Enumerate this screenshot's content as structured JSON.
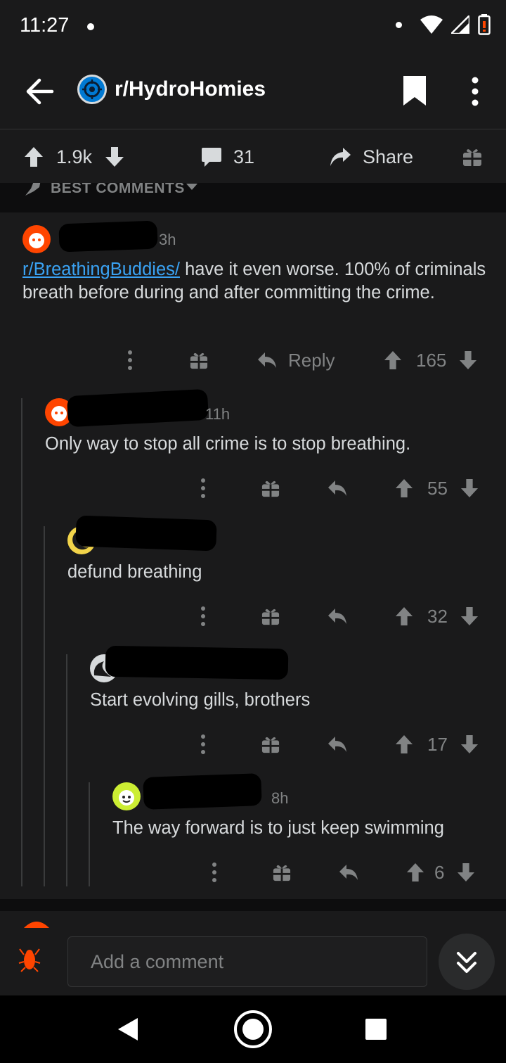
{
  "status_bar": {
    "time": "11:27"
  },
  "header": {
    "subreddit": "r/HydroHomies"
  },
  "action_bar": {
    "upvotes": "1.9k",
    "comments": "31",
    "share_label": "Share"
  },
  "sort": {
    "label": "BEST COMMENTS"
  },
  "comments": [
    {
      "time": "3h",
      "link_text": "r/BreathingBuddies/",
      "text": " have it even worse.  100% of criminals breath before during and after committing the crime.",
      "reply_label": "Reply",
      "score": "165"
    },
    {
      "time": "11h",
      "text": "Only way to stop all crime is to stop breathing.",
      "score": "55"
    },
    {
      "time": "",
      "text": "defund breathing",
      "score": "32"
    },
    {
      "time": "",
      "text": "Start evolving gills, brothers",
      "score": "17"
    },
    {
      "time": "8h",
      "text": "The way forward is to just keep swimming",
      "score": "6"
    }
  ],
  "comment_bar": {
    "placeholder": "Add a comment"
  },
  "colors": {
    "background": "#1a1a1b",
    "link": "#3aa2f3",
    "muted": "#818384",
    "text": "#d7dadc"
  }
}
